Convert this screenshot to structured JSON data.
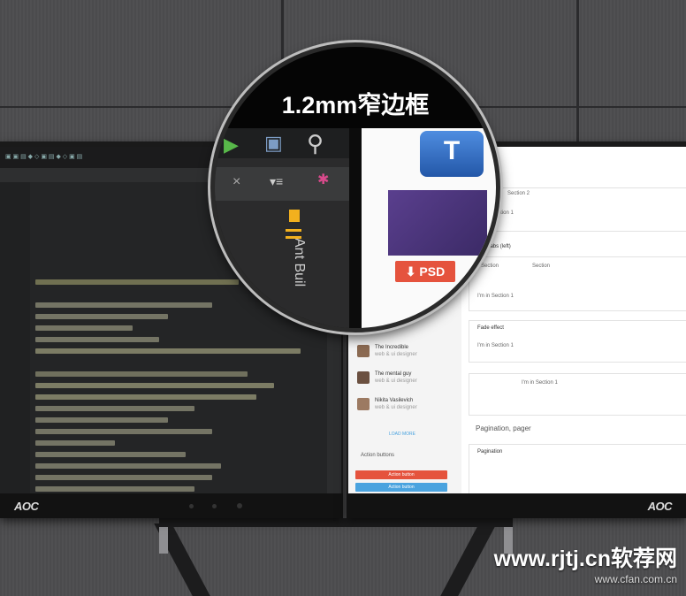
{
  "callout": {
    "title": "1.2mm窄边框",
    "arrows": "→ ←"
  },
  "left_monitor": {
    "brand": "AOC",
    "ide_label": "Ant Buil"
  },
  "right_monitor": {
    "brand": "AOC",
    "badge": "PSD",
    "tile_letter": "T",
    "sections": {
      "section2": "Section 2",
      "in_section1": "I'm in Section 1",
      "yellow_tabs": "Yellow tabs (left)",
      "tab_section": "Section",
      "fade_effect": "Fade effect",
      "pagination_pager": "Pagination, pager",
      "pagination": "Pagination",
      "action_buttons": "Action buttons",
      "action_button": "Action button",
      "load_more": "LOAD MORE"
    },
    "people": [
      {
        "name": "The Incredible",
        "role": "web & ui designer"
      },
      {
        "name": "The mental guy",
        "role": "web & ui designer"
      },
      {
        "name": "Nikita Vasilevich",
        "role": "web & ui designer"
      }
    ]
  },
  "watermark": {
    "site": "www.rjtj.cn软荐网",
    "site2": "www.cfan.com.cn"
  },
  "colors": {
    "psd_red": "#e5533d",
    "tile_blue": "#3b73c4",
    "action_red": "#e5533d",
    "action_blue": "#4aa3df",
    "ant_yellow": "#f2b01e"
  }
}
